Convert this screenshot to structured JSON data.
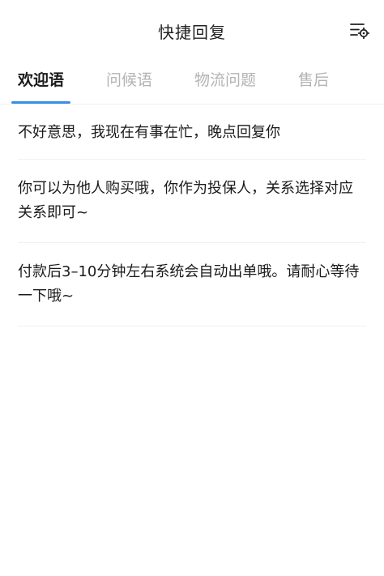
{
  "header": {
    "title": "快捷回复",
    "settings_icon": "settings-list-icon"
  },
  "tabs": [
    {
      "label": "欢迎语",
      "active": true
    },
    {
      "label": "问候语",
      "active": false
    },
    {
      "label": "物流问题",
      "active": false
    },
    {
      "label": "售后",
      "active": false
    }
  ],
  "replies": [
    {
      "text": "不好意思，我现在有事在忙，晚点回复你"
    },
    {
      "text": "你可以为他人购买哦，你作为投保人，关系选择对应关系即可~"
    },
    {
      "text": "付款后3–10分钟左右系统会自动出单哦。请耐心等待一下哦~"
    }
  ],
  "colors": {
    "accent": "#3a8ee6",
    "tab_inactive": "#b3b3b3",
    "divider": "#f0f0f0"
  }
}
